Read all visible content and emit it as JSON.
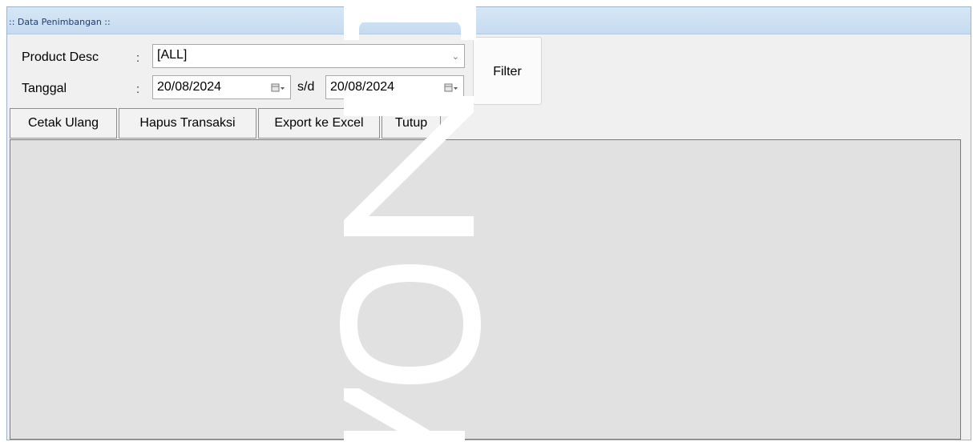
{
  "window": {
    "title": ":: Data Penimbangan ::"
  },
  "filters": {
    "product_label": "Product Desc",
    "product_colon": ":",
    "product_value": "[ALL]",
    "date_label": "Tanggal",
    "date_colon": ":",
    "date_from": "20/08/2024",
    "range_sep": "s/d",
    "date_to": "20/08/2024",
    "filter_label": "Filter"
  },
  "toolbar": {
    "cetak_label": "Cetak Ulang",
    "hapus_label": "Hapus Transaksi",
    "export_label": "Export ke Excel",
    "tutup_label": "Tutup"
  },
  "colors": {
    "titlebar": "#c6dbf0",
    "grid_background": "#e1e1e1",
    "form_background": "#f0f0f0"
  },
  "icons": {
    "dropdown": "chevron-down-icon",
    "calendar": "calendar-icon"
  }
}
